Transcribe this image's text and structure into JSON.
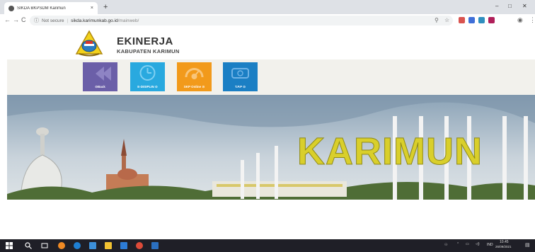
{
  "browser": {
    "tab_title": "SIKDA BKPSDM Karimun",
    "tab_close": "×",
    "new_tab": "+",
    "window_controls": [
      "–",
      "□",
      "✕"
    ],
    "nav": {
      "back": "←",
      "forward": "→",
      "reload": "C"
    },
    "security_label": "Not secure",
    "url_domain": "sikda.karimunkab.go.id",
    "url_path": "/mainweb/"
  },
  "site": {
    "title": "EKINERJA",
    "subtitle": "KABUPATEN KARIMUN"
  },
  "nav_tiles": [
    {
      "label": "Back",
      "color": "#6b5fa8"
    },
    {
      "label": "E-DISIPLIN",
      "color": "#29a9df"
    },
    {
      "label": "SKP Online",
      "color": "#f29a1b"
    },
    {
      "label": "T.P.P",
      "color": "#1b7fc4"
    }
  ],
  "hero": {
    "sign_text": "KARIMUN"
  },
  "taskbar": {
    "language": "IND",
    "time": "10.45",
    "date": "26/09/2021"
  }
}
